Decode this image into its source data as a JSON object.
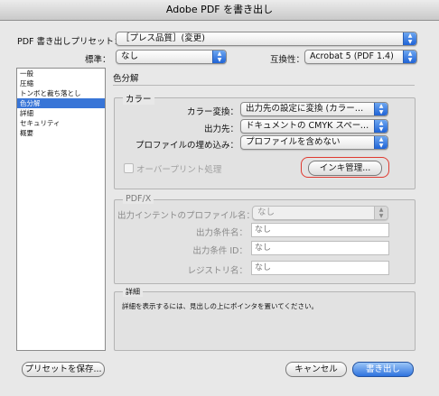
{
  "window": {
    "title": "Adobe PDF を書き出し"
  },
  "top": {
    "preset_label": "PDF 書き出しプリセット：",
    "preset_value": "［プレス品質］(変更)",
    "standard_label": "標準：",
    "standard_value": "なし",
    "compat_label": "互換性：",
    "compat_value": "Acrobat 5 (PDF 1.4)"
  },
  "sidebar": {
    "items": [
      {
        "label": "一般"
      },
      {
        "label": "圧縮"
      },
      {
        "label": "トンボと裁ち落とし"
      },
      {
        "label": "色分解"
      },
      {
        "label": "詳細"
      },
      {
        "label": "セキュリティ"
      },
      {
        "label": "概要"
      }
    ],
    "selected_index": 3
  },
  "panel": {
    "title": "色分解",
    "color_group": {
      "title": "カラー",
      "conversion_label": "カラー変換：",
      "conversion_value": "出力先の設定に変換 (カラー値を保…",
      "destination_label": "出力先：",
      "destination_value": "ドキュメントの CMYK スペース - …",
      "profile_label": "プロファイルの埋め込み：",
      "profile_value": "プロファイルを含めない",
      "overprint_label": "オーバープリント処理",
      "ink_button": "インキ管理..."
    },
    "pdfx_group": {
      "title": "PDF/X",
      "intent_label": "出力インテントのプロファイル名：",
      "intent_value": "なし",
      "condition_name_label": "出力条件名：",
      "condition_name_value": "なし",
      "condition_id_label": "出力条件 ID：",
      "condition_id_value": "なし",
      "registry_label": "レジストリ名：",
      "registry_value": "なし"
    },
    "detail_group": {
      "title": "詳細",
      "text": "詳細を表示するには、見出しの上にポインタを置いてください。"
    }
  },
  "footer": {
    "save_preset": "プリセットを保存...",
    "cancel": "キャンセル",
    "export": "書き出し"
  },
  "colors": {
    "accent": "#3875d7",
    "highlight": "#e03a30"
  }
}
